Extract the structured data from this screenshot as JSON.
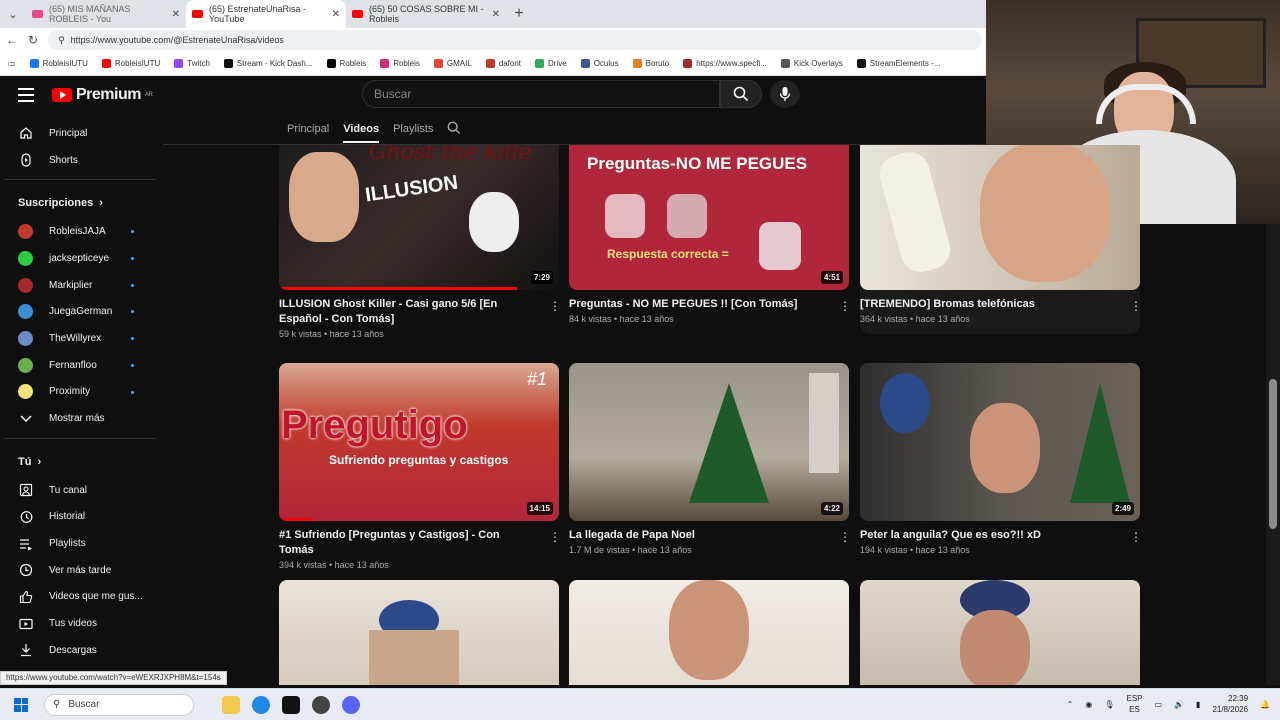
{
  "browser": {
    "tabs": [
      {
        "label": "(65) MIS MAÑANAS ROBLEIS - You",
        "active": false
      },
      {
        "label": "(65) EstrenateUnaRisa - YouTube",
        "active": true
      },
      {
        "label": "(65) 50 COSAS SOBRE MI - Robleis",
        "active": false
      }
    ],
    "url": "https://www.youtube.com/@EstrenateUnaRisa/videos",
    "bookmarks": [
      "RobleisIUTU",
      "RobleisIUTU",
      "Twitch",
      "Stream - Kick Dash...",
      "Robleis",
      "Robleis",
      "GMAIL",
      "dafont",
      "Drive",
      "Oculus",
      "Boruto",
      "https://www.specfi...",
      "Kick Overlays",
      "StreamElements -..."
    ],
    "status_url": "https://www.youtube.com/watch?v=eWEXRJXPH8M&t=154s"
  },
  "youtube": {
    "logo_text": "Premium",
    "logo_region": "AR",
    "search_placeholder": "Buscar"
  },
  "sidebar": {
    "main": [
      {
        "label": "Principal",
        "icon": "home-icon"
      },
      {
        "label": "Shorts",
        "icon": "shorts-icon"
      }
    ],
    "subs_header": "Suscripciones",
    "subs": [
      {
        "label": "RobleisJAJA",
        "color": "#c0392b"
      },
      {
        "label": "jacksepticeye",
        "color": "#2ecc40"
      },
      {
        "label": "Markiplier",
        "color": "#a52a2a"
      },
      {
        "label": "JuegaGerman",
        "color": "#3b8fd6"
      },
      {
        "label": "TheWillyrex",
        "color": "#6a8cc7"
      },
      {
        "label": "Fernanfloo",
        "color": "#6ab04c"
      },
      {
        "label": "Proximity",
        "color": "#f5e27a"
      }
    ],
    "show_more": "Mostrar más",
    "you_header": "Tú",
    "you": [
      {
        "label": "Tu canal",
        "icon": "channel-icon"
      },
      {
        "label": "Historial",
        "icon": "history-icon"
      },
      {
        "label": "Playlists",
        "icon": "playlists-icon"
      },
      {
        "label": "Ver más tarde",
        "icon": "clock-icon"
      },
      {
        "label": "Videos que me gus...",
        "icon": "like-icon"
      },
      {
        "label": "Tus videos",
        "icon": "video-icon"
      },
      {
        "label": "Descargas",
        "icon": "download-icon"
      }
    ]
  },
  "channel_tabs": [
    "Principal",
    "Videos",
    "Playlists"
  ],
  "videos": [
    {
      "title": "ILLUSION Ghost Killer - Casi gano 5/6 [En Español - Con Tomás]",
      "meta": "59 k vistas • hace 13 años",
      "duration": "7:29",
      "bg": "#1a1a1a",
      "progress": 0.85
    },
    {
      "title": "Preguntas - NO ME PEGUES !! [Con Tomás]",
      "meta": "84 k vistas • hace 13 años",
      "duration": "4:51",
      "bg": "#b0263a",
      "progress": 0
    },
    {
      "title": "[TREMENDO] Bromas telefónicas",
      "meta": "364 k vistas • hace 13 años",
      "duration": "",
      "bg": "#c8c4be",
      "progress": 0
    },
    {
      "title": "#1 Sufriendo [Preguntas y Castigos] - Con Tomás",
      "meta": "394 k vistas • hace 13 años",
      "duration": "14:15",
      "bg": "#c0392b",
      "progress": 0.12
    },
    {
      "title": "La llegada de Papa Noel",
      "meta": "1.7 M de vistas • hace 13 años",
      "duration": "4:22",
      "bg": "#8a8476",
      "progress": 0
    },
    {
      "title": "Peter la anguila? Que es eso?!! xD",
      "meta": "194 k vistas • hace 13 años",
      "duration": "2:49",
      "bg": "#4a4844",
      "progress": 0
    },
    {
      "title": "",
      "meta": "",
      "duration": "",
      "bg": "#d8cfc2",
      "progress": 0
    },
    {
      "title": "",
      "meta": "",
      "duration": "",
      "bg": "#e2dcd3",
      "progress": 0
    },
    {
      "title": "",
      "meta": "",
      "duration": "",
      "bg": "#d2cbc0",
      "progress": 0
    }
  ],
  "thumb_text": {
    "v1": "ILLUSION",
    "v1b": "Ghost the kille",
    "v2": "Preguntas-NO ME PEGUES",
    "v2b": "Respuesta correcta =",
    "v4": "Pregutigo",
    "v4b": "Sufriendo preguntas y castigos",
    "v4c": "#1"
  },
  "taskbar": {
    "search": "Buscar",
    "lang1": "ESP",
    "lang2": "ES",
    "time": "22:39",
    "date": "21/8/2026"
  }
}
